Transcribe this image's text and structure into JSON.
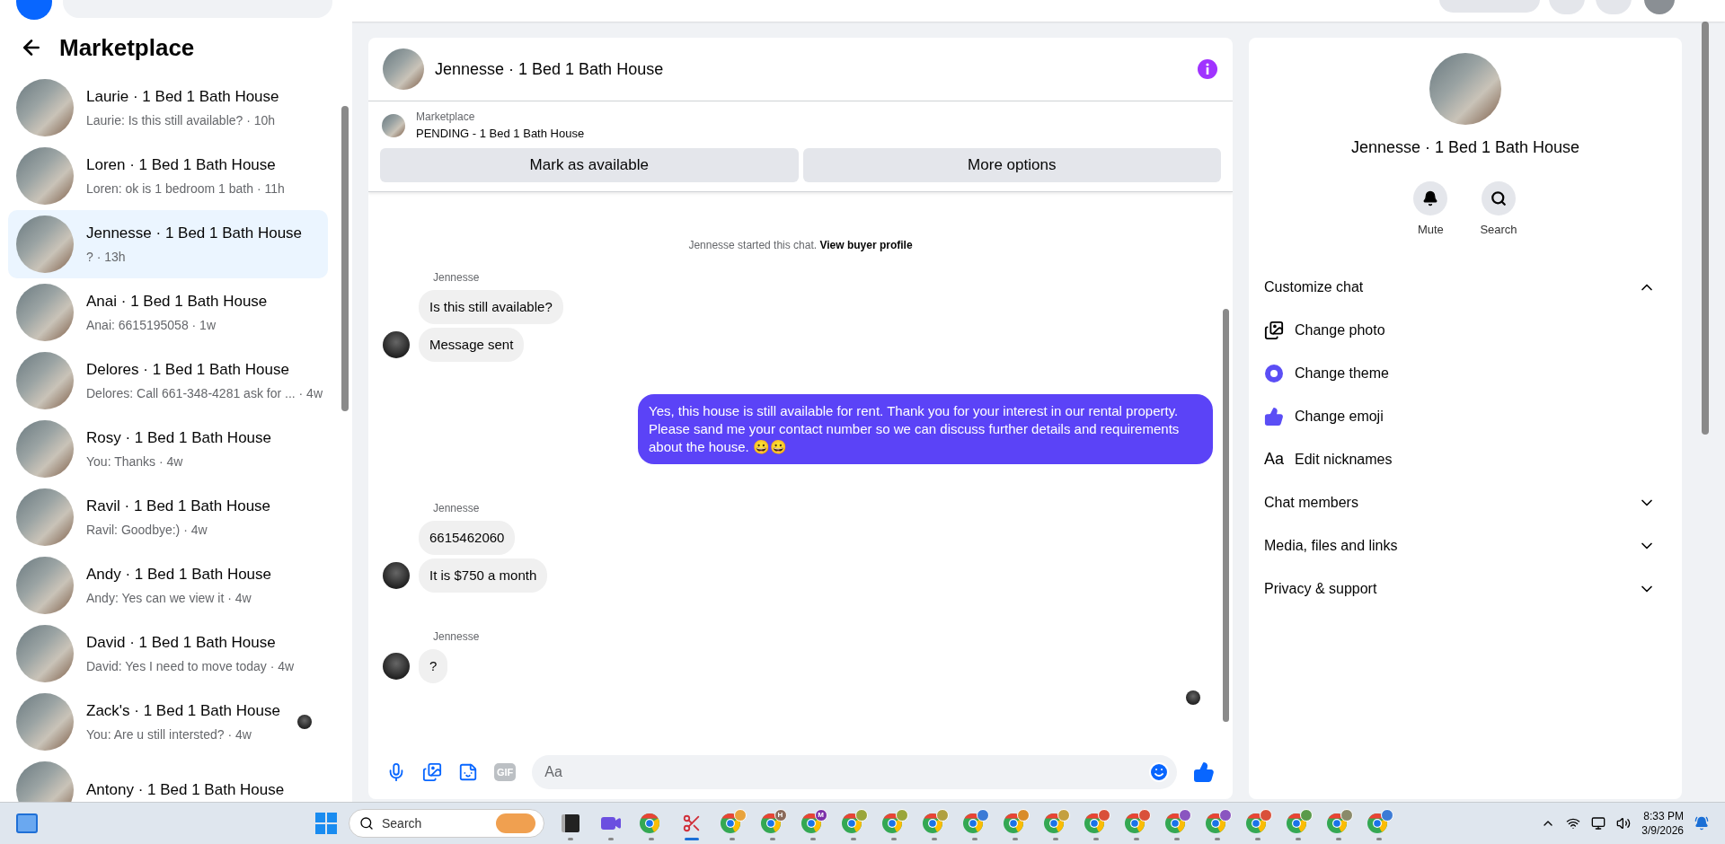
{
  "sidebar": {
    "title": "Marketplace",
    "conversations": [
      {
        "title": "Laurie · 1 Bed 1 Bath House",
        "meta": "Laurie: Is this still available? · 10h",
        "selected": false,
        "seen_avatar": false
      },
      {
        "title": "Loren · 1 Bed 1 Bath House",
        "meta": "Loren: ok is 1 bedroom 1 bath · 11h",
        "selected": false,
        "seen_avatar": false
      },
      {
        "title": "Jennesse · 1 Bed 1 Bath House",
        "meta": "? · 13h",
        "selected": true,
        "seen_avatar": false
      },
      {
        "title": "Anai · 1 Bed 1 Bath House",
        "meta": "Anai: 6615195058 · 1w",
        "selected": false,
        "seen_avatar": false
      },
      {
        "title": "Delores · 1 Bed 1 Bath House",
        "meta": "Delores: Call 661-348-4281 ask for ... · 4w",
        "selected": false,
        "seen_avatar": false
      },
      {
        "title": "Rosy · 1 Bed 1 Bath House",
        "meta": "You: Thanks · 4w",
        "selected": false,
        "seen_avatar": false
      },
      {
        "title": "Ravil · 1 Bed 1 Bath House",
        "meta": "Ravil: Goodbye:) · 4w",
        "selected": false,
        "seen_avatar": false
      },
      {
        "title": "Andy · 1 Bed 1 Bath House",
        "meta": "Andy: Yes can we view it · 4w",
        "selected": false,
        "seen_avatar": false
      },
      {
        "title": "David · 1 Bed 1 Bath House",
        "meta": "David: Yes I need to move today · 4w",
        "selected": false,
        "seen_avatar": false
      },
      {
        "title": "Zack's · 1 Bed 1 Bath House",
        "meta": "You: Are u still intersted? · 4w",
        "selected": false,
        "seen_avatar": true
      },
      {
        "title": "Antony · 1 Bed 1 Bath House",
        "selected": false,
        "seen_avatar": false
      }
    ]
  },
  "chat": {
    "title": "Jennesse · 1 Bed 1 Bath House",
    "listing": {
      "label": "Marketplace",
      "status": "PENDING - 1 Bed 1 Bath House"
    },
    "actions": [
      "Mark as available",
      "More options"
    ],
    "system_note": {
      "text": "Jennesse started this chat.",
      "link": "View buyer profile"
    },
    "groups": [
      {
        "outgoing": false,
        "sender": "Jennesse",
        "messages": [
          "Is this still available?",
          "Message sent"
        ]
      },
      {
        "outgoing": true,
        "messages": [
          "Yes, this house is still available for rent. Thank you for your interest in our rental property. Please sand me your contact number so we can discuss further details and requirements about the house. 😀😀"
        ]
      },
      {
        "outgoing": false,
        "sender": "Jennesse",
        "messages": [
          "6615462060",
          "It is $750 a month"
        ]
      },
      {
        "outgoing": false,
        "sender": "Jennesse",
        "messages": [
          "?"
        ]
      }
    ],
    "composer": {
      "placeholder": "Aa",
      "gif_label": "GIF"
    }
  },
  "details": {
    "title": "Jennesse · 1 Bed 1 Bath House",
    "actions": [
      {
        "kind": "mute",
        "label": "Mute"
      },
      {
        "kind": "search",
        "label": "Search"
      }
    ],
    "sections": [
      {
        "title": "Customize chat",
        "expanded": true,
        "items": [
          {
            "kind": "photo",
            "label": "Change photo"
          },
          {
            "kind": "theme",
            "label": "Change theme"
          },
          {
            "kind": "emoji",
            "label": "Change emoji"
          },
          {
            "kind": "nicknames",
            "label": "Edit nicknames",
            "icon_text": "Aa"
          }
        ]
      },
      {
        "title": "Chat members",
        "expanded": false
      },
      {
        "title": "Media, files and links",
        "expanded": false
      },
      {
        "title": "Privacy & support",
        "expanded": false
      }
    ]
  },
  "taskbar": {
    "search_placeholder": "Search",
    "apps": [
      {
        "kind": "task-view",
        "active": false
      },
      {
        "kind": "meet",
        "active": false
      },
      {
        "kind": "browser",
        "active": false
      },
      {
        "kind": "snip",
        "active": true
      },
      {
        "kind": "browser",
        "color": "#e8a33c",
        "active": false
      },
      {
        "kind": "browser",
        "badge": "H",
        "color": "#8a6a5a",
        "active": false
      },
      {
        "kind": "browser",
        "badge": "M",
        "color": "#7b2fa8",
        "active": false
      },
      {
        "kind": "browser",
        "color": "#9aa63a",
        "active": false
      },
      {
        "kind": "browser",
        "color": "#9aa63a",
        "active": false
      },
      {
        "kind": "browser",
        "color": "#b0a040",
        "active": false
      },
      {
        "kind": "browser",
        "color": "#3c7bd6",
        "active": false
      },
      {
        "kind": "browser",
        "color": "#d98c2a",
        "active": false
      },
      {
        "kind": "browser",
        "color": "#c4a040",
        "active": false
      },
      {
        "kind": "browser",
        "color": "#d9503a",
        "active": false
      },
      {
        "kind": "browser",
        "color": "#d9503a",
        "active": false
      },
      {
        "kind": "browser",
        "color": "#8a55c0",
        "active": false
      },
      {
        "kind": "browser",
        "color": "#8a55c0",
        "active": false
      },
      {
        "kind": "browser",
        "color": "#d9503a",
        "active": false
      },
      {
        "kind": "browser",
        "color": "#5a9a4a",
        "active": false
      },
      {
        "kind": "browser",
        "color": "#8a8a6a",
        "active": false
      },
      {
        "kind": "browser",
        "color": "#3c7bd6",
        "active": false
      }
    ],
    "time": "8:33 PM",
    "date": "3/9/2026"
  }
}
